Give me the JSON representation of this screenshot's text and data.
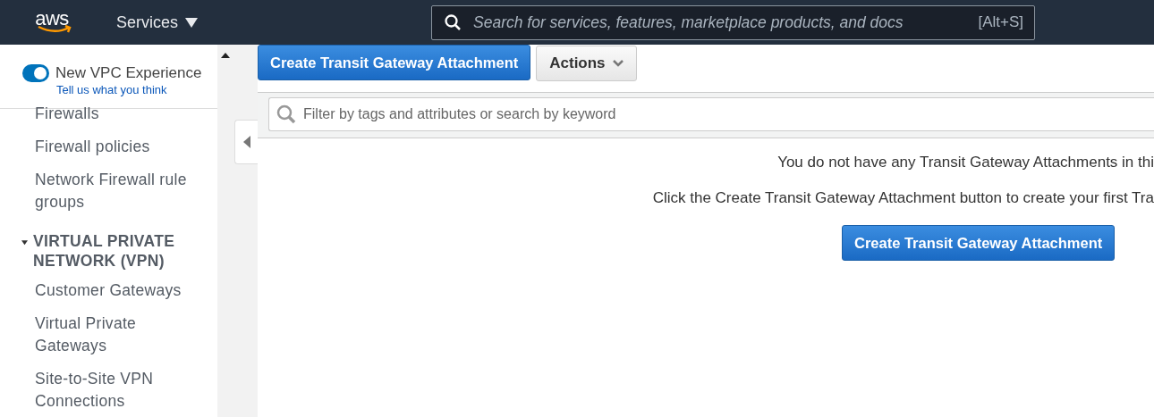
{
  "top_bar": {
    "logo": "aws",
    "services_menu": "Services",
    "search": {
      "placeholder": "Search for services, features, marketplace products, and docs",
      "shortcut": "[Alt+S]"
    }
  },
  "sidebar": {
    "toggle": {
      "label": "New VPC Experience",
      "on": true
    },
    "feedback_link": "Tell us what you think",
    "items": [
      {
        "kind": "link",
        "label": "Firewalls"
      },
      {
        "kind": "link",
        "label": "Firewall policies"
      },
      {
        "kind": "link",
        "label": "Network Firewall rule groups"
      },
      {
        "kind": "section",
        "label": "VIRTUAL PRIVATE NETWORK (VPN)",
        "expanded": true
      },
      {
        "kind": "link",
        "label": "Customer Gateways"
      },
      {
        "kind": "link",
        "label": "Virtual Private Gateways"
      },
      {
        "kind": "link",
        "label": "Site-to-Site VPN Connections"
      }
    ]
  },
  "toolbar": {
    "create_button": "Create Transit Gateway Attachment",
    "actions_button": "Actions"
  },
  "filter": {
    "placeholder": "Filter by tags and attributes or search by keyword"
  },
  "empty_state": {
    "lines": [
      "You do not have any Transit Gateway Attachments in thi",
      "Click the Create Transit Gateway Attachment button to create your first Tra"
    ],
    "button": "Create Transit Gateway Attachment"
  }
}
